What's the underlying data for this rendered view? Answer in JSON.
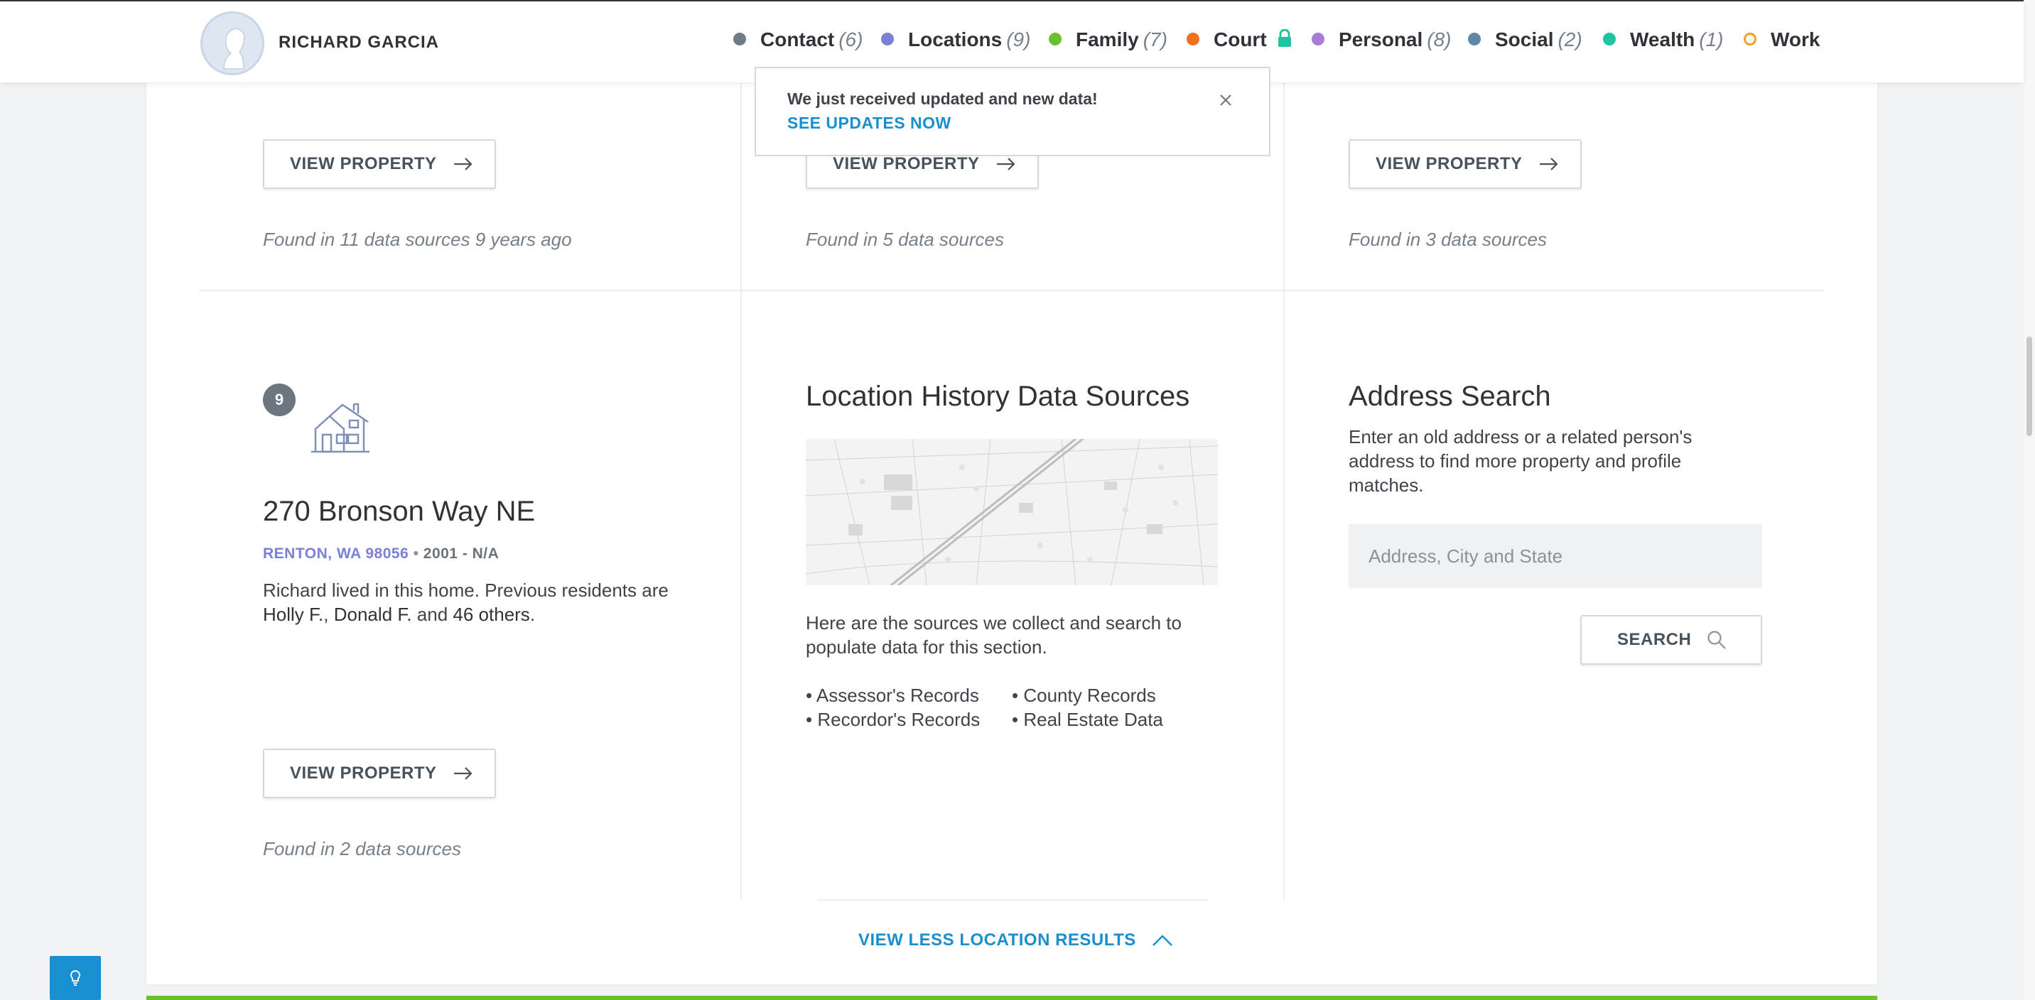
{
  "header": {
    "person_name": "RICHARD GARCIA",
    "nav": [
      {
        "label": "Contact",
        "count": "(6)",
        "color": "#6f7c88"
      },
      {
        "label": "Locations",
        "count": "(9)",
        "color": "#7b7fd6"
      },
      {
        "label": "Family",
        "count": "(7)",
        "color": "#6cbf2f"
      },
      {
        "label": "Court",
        "count": "",
        "color": "#f0711d"
      },
      {
        "label": "Personal",
        "count": "(8)",
        "color": "#a97ad8"
      },
      {
        "label": "Social",
        "count": "(2)",
        "color": "#5f86a6"
      },
      {
        "label": "Wealth",
        "count": "(1)",
        "color": "#1fc4a3"
      },
      {
        "label": "Work",
        "count": "",
        "color": "#f0a21d"
      }
    ]
  },
  "notification": {
    "message": "We just received updated and new data!",
    "link": "SEE UPDATES NOW"
  },
  "top_row": [
    {
      "button": "VIEW PROPERTY",
      "found": "Found in 11 data sources 9 years ago"
    },
    {
      "button": "VIEW PROPERTY",
      "found": "Found in 5 data sources"
    },
    {
      "button": "VIEW PROPERTY",
      "found": "Found in 3 data sources"
    }
  ],
  "property": {
    "badge": "9",
    "address": "270 Bronson Way NE",
    "city": "RENTON, WA 98056",
    "years": "2001 - N/A",
    "desc_1": "Richard lived in this home. Previous residents are",
    "resident_1": "Holly F.",
    "resident_2": "Donald F.",
    "and": "and",
    "others": "46 others",
    "button": "VIEW PROPERTY",
    "found": "Found in 2 data sources"
  },
  "data_sources": {
    "title": "Location History Data Sources",
    "desc": "Here are the sources we collect and search to populate data for this section.",
    "col1": [
      "Assessor's Records",
      "Recordor's Records"
    ],
    "col2": [
      "County Records",
      "Real Estate Data"
    ]
  },
  "address_search": {
    "title": "Address Search",
    "desc": "Enter an old address or a related person's address to find more property and profile matches.",
    "placeholder": "Address, City and State",
    "button": "SEARCH"
  },
  "footer": {
    "view_less": "VIEW LESS LOCATION RESULTS"
  },
  "colors": {
    "accent_link": "#1a8fd0",
    "city_link": "#7b7fd6",
    "help_button": "#1a8fd0",
    "bottom_bar": "#6cbf2f"
  }
}
